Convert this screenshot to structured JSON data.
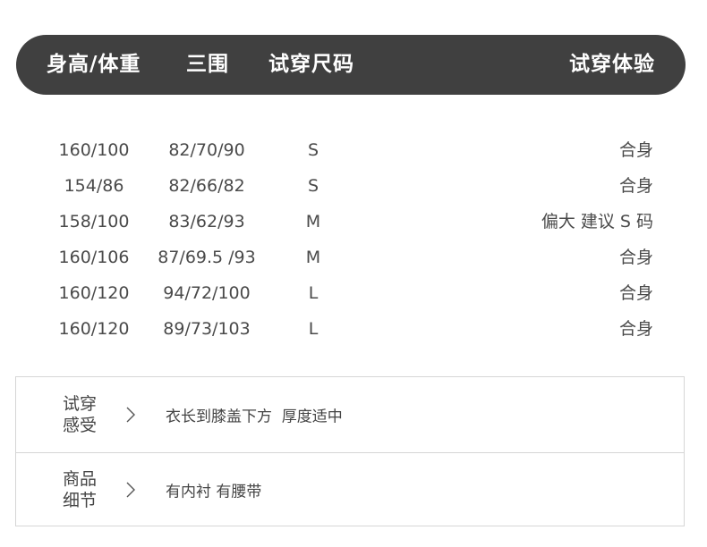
{
  "header": {
    "col_body": "身高/体重",
    "col_measurements": "三围",
    "col_size": "试穿尺码",
    "col_experience": "试穿体验"
  },
  "rows": [
    {
      "body": "160/100",
      "measurements": "82/70/90",
      "size": "S",
      "experience": "合身"
    },
    {
      "body": "154/86",
      "measurements": "82/66/82",
      "size": "S",
      "experience": "合身"
    },
    {
      "body": "158/100",
      "measurements": "83/62/93",
      "size": "M",
      "experience": "偏大 建议 S 码"
    },
    {
      "body": "160/106",
      "measurements": "87/69.5 /93",
      "size": "M",
      "experience": "合身"
    },
    {
      "body": "160/120",
      "measurements": "94/72/100",
      "size": "L",
      "experience": "合身"
    },
    {
      "body": "160/120",
      "measurements": "89/73/103",
      "size": "L",
      "experience": "合身"
    }
  ],
  "details": [
    {
      "label_line1": "试穿",
      "label_line2": "感受",
      "icon": "chevron-right-icon",
      "text": "衣长到膝盖下方  厚度适中"
    },
    {
      "label_line1": "商品",
      "label_line2": "细节",
      "icon": "chevron-right-icon",
      "text": "有内衬 有腰带"
    }
  ]
}
